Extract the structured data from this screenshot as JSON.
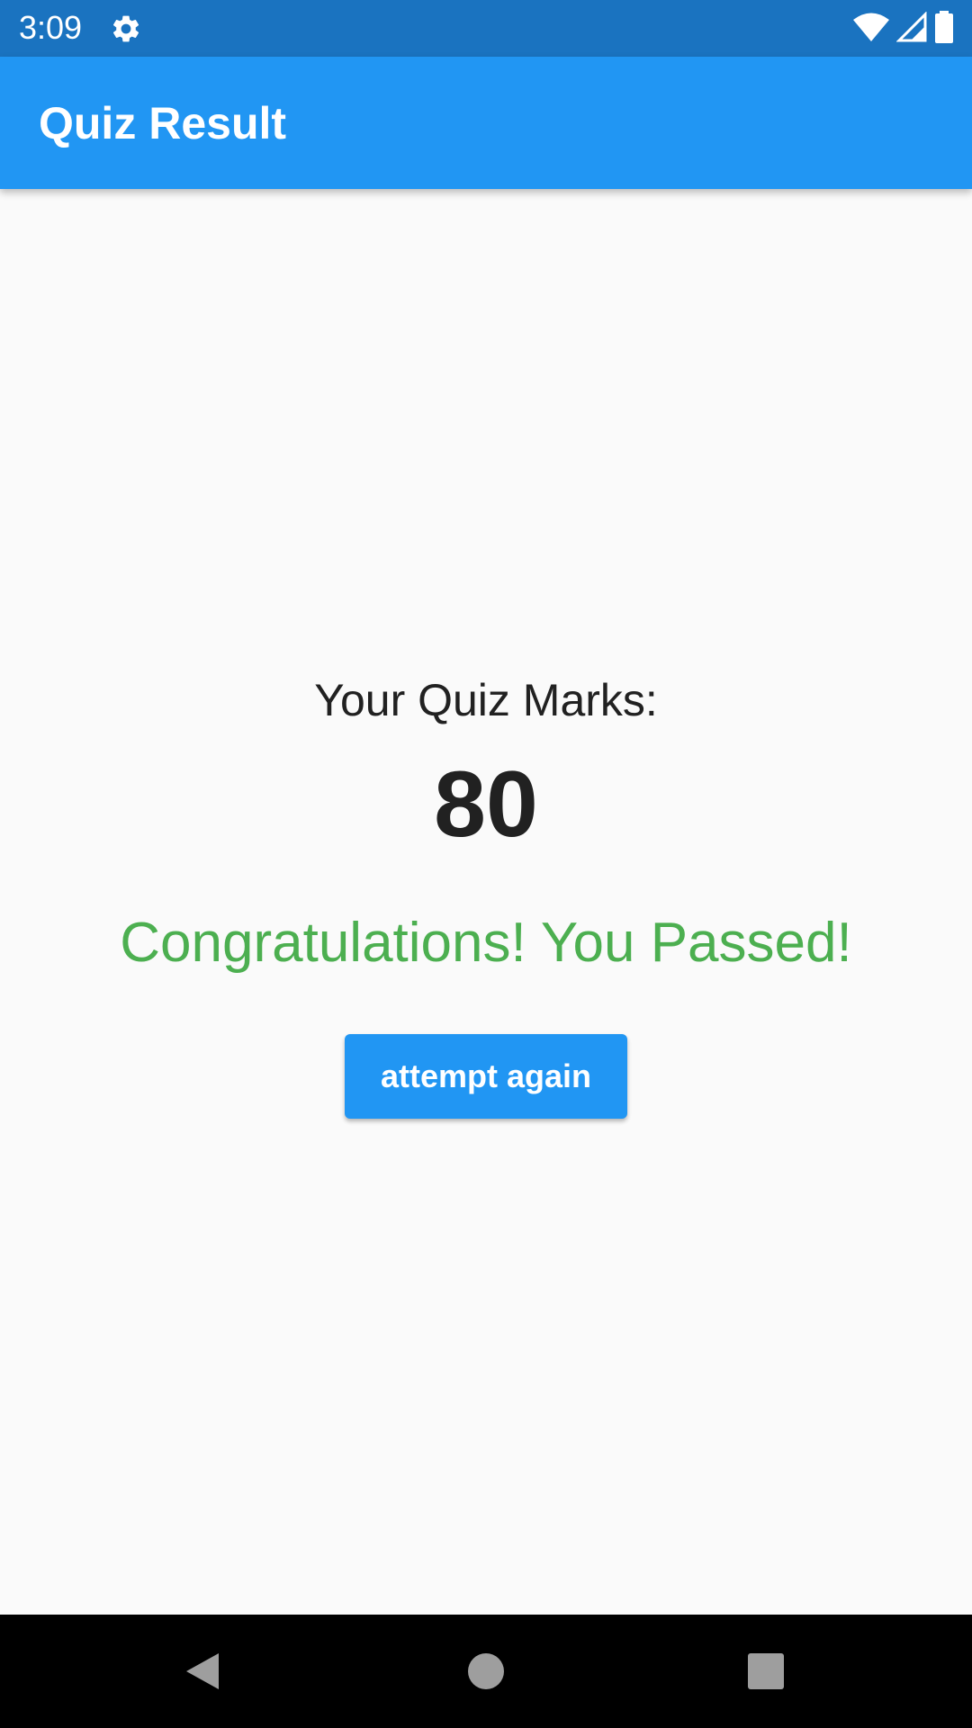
{
  "status_bar": {
    "time": "3:09",
    "icons": [
      "gear-icon",
      "wifi-icon",
      "signal-icon",
      "battery-icon"
    ],
    "color": "#1a73c0"
  },
  "app_bar": {
    "title": "Quiz Result",
    "color": "#2196f3"
  },
  "result": {
    "label": "Your Quiz Marks:",
    "marks": "80",
    "message": "Congratulations! You Passed!",
    "message_color": "#4caf50"
  },
  "actions": {
    "attempt_again_label": "attempt again"
  },
  "nav_bar": {
    "icons": [
      "back-icon",
      "home-icon",
      "recents-icon"
    ]
  }
}
